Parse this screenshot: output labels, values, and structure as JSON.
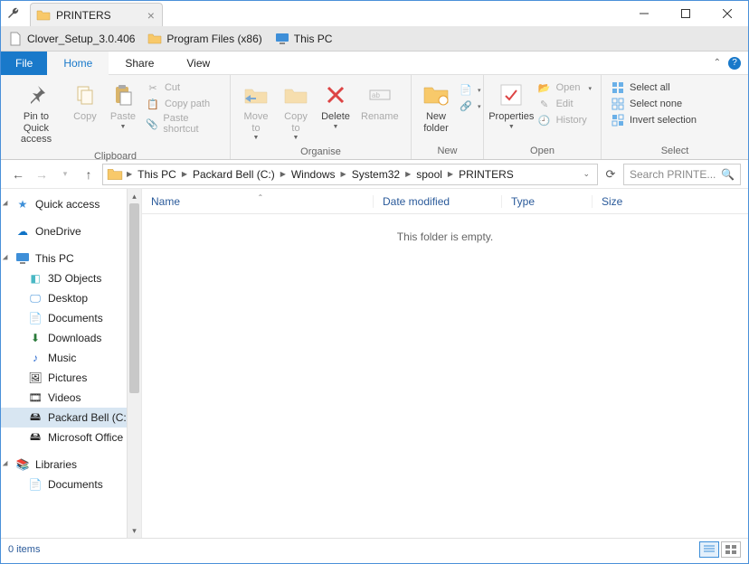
{
  "window": {
    "tab_title": "PRINTERS"
  },
  "bookmarks": [
    {
      "label": "Clover_Setup_3.0.406",
      "icon": "file"
    },
    {
      "label": "Program Files (x86)",
      "icon": "folder"
    },
    {
      "label": "This PC",
      "icon": "pc"
    }
  ],
  "ribbon_tabs": {
    "file": "File",
    "home": "Home",
    "share": "Share",
    "view": "View"
  },
  "ribbon": {
    "clipboard": {
      "label": "Clipboard",
      "pin": "Pin to Quick\naccess",
      "copy": "Copy",
      "paste": "Paste",
      "cut": "Cut",
      "copy_path": "Copy path",
      "paste_shortcut": "Paste shortcut"
    },
    "organise": {
      "label": "Organise",
      "move_to": "Move\nto",
      "copy_to": "Copy\nto",
      "delete": "Delete",
      "rename": "Rename"
    },
    "new": {
      "label": "New",
      "new_folder": "New\nfolder"
    },
    "open": {
      "label": "Open",
      "properties": "Properties",
      "open": "Open",
      "edit": "Edit",
      "history": "History"
    },
    "select": {
      "label": "Select",
      "all": "Select all",
      "none": "Select none",
      "invert": "Invert selection"
    }
  },
  "breadcrumb": [
    "This PC",
    "Packard Bell (C:)",
    "Windows",
    "System32",
    "spool",
    "PRINTERS"
  ],
  "search_placeholder": "Search PRINTE...",
  "nav": {
    "quick_access": "Quick access",
    "onedrive": "OneDrive",
    "this_pc": "This PC",
    "children": [
      "3D Objects",
      "Desktop",
      "Documents",
      "Downloads",
      "Music",
      "Pictures",
      "Videos",
      "Packard Bell (C:)",
      "Microsoft Office"
    ],
    "libraries": "Libraries",
    "lib_children": [
      "Documents"
    ]
  },
  "columns": {
    "name": "Name",
    "date": "Date modified",
    "type": "Type",
    "size": "Size"
  },
  "empty_text": "This folder is empty.",
  "status_text": "0 items"
}
